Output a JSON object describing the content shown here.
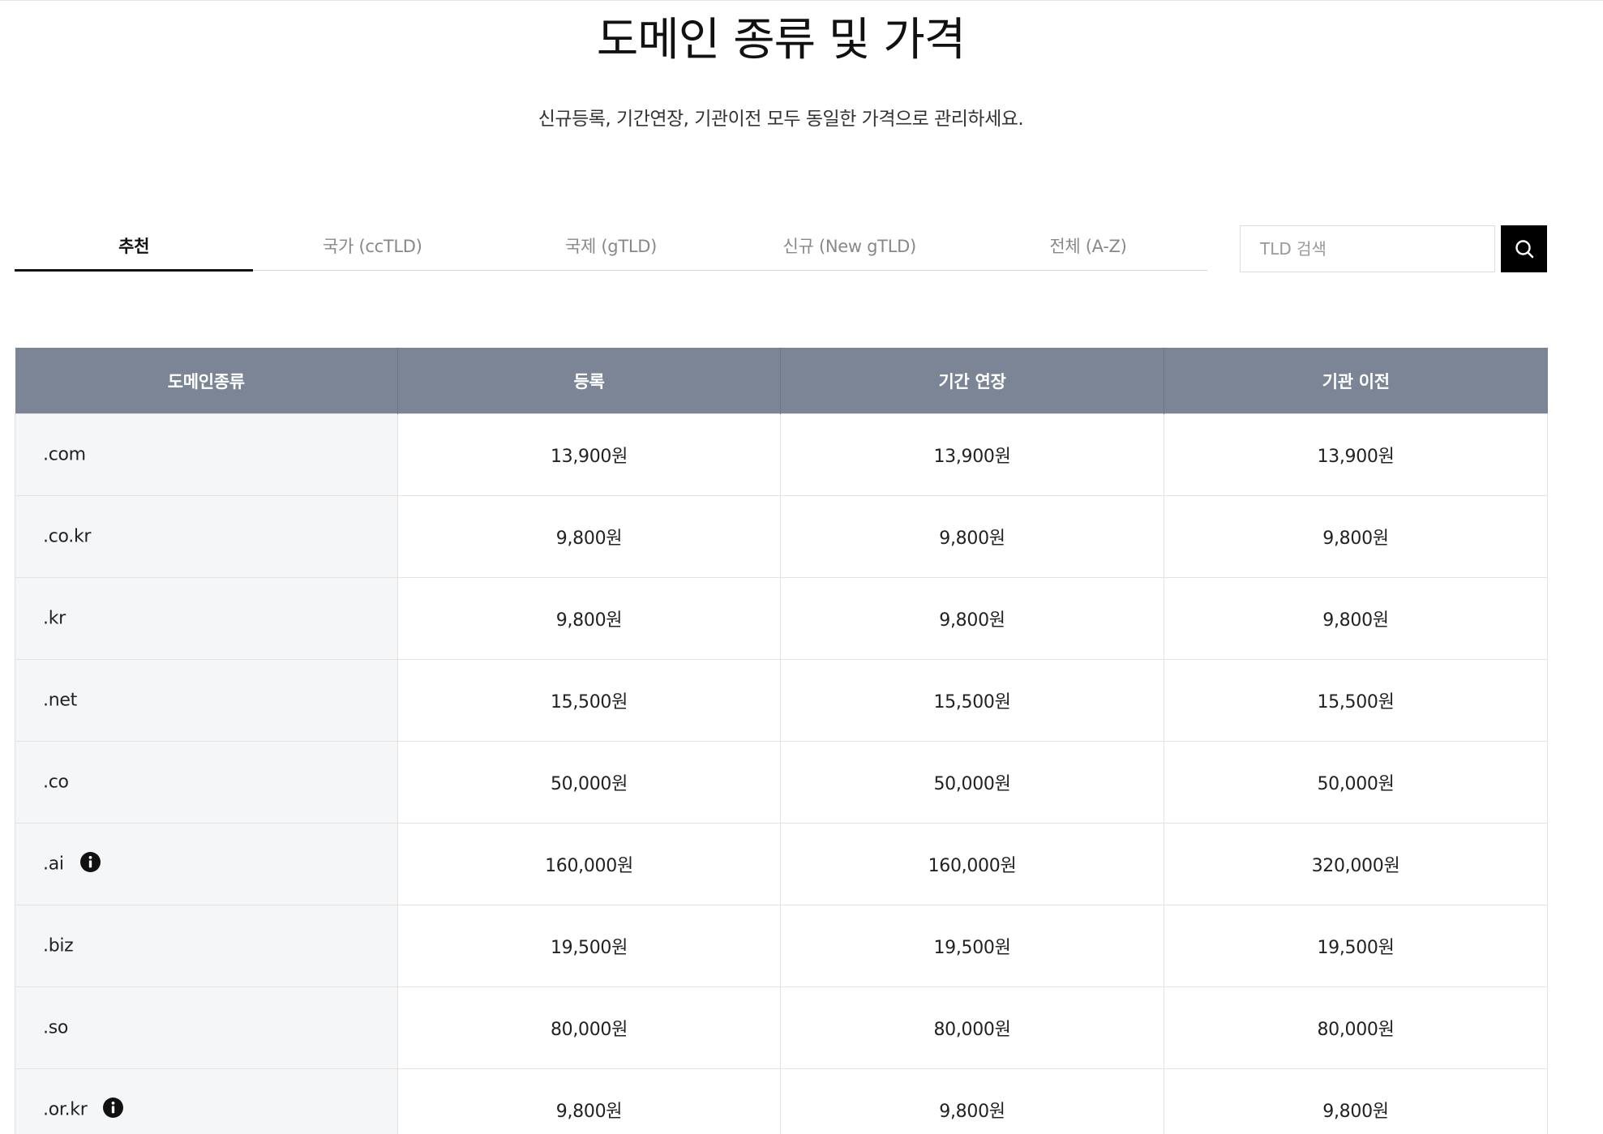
{
  "header": {
    "title": "도메인 종류 및 가격",
    "subtitle": "신규등록, 기간연장, 기관이전 모두 동일한 가격으로 관리하세요."
  },
  "tabs": [
    {
      "label": "추천",
      "active": true
    },
    {
      "label": "국가 (ccTLD)",
      "active": false
    },
    {
      "label": "국제 (gTLD)",
      "active": false
    },
    {
      "label": "신규 (New gTLD)",
      "active": false
    },
    {
      "label": "전체 (A-Z)",
      "active": false
    }
  ],
  "search": {
    "placeholder": "TLD 검색",
    "value": "",
    "button_icon": "search-icon"
  },
  "table": {
    "headers": [
      "도메인종류",
      "등록",
      "기간 연장",
      "기관 이전"
    ],
    "rows": [
      {
        "domain": ".com",
        "info_icon": false,
        "register": "13,900원",
        "renew": "13,900원",
        "transfer": "13,900원"
      },
      {
        "domain": ".co.kr",
        "info_icon": false,
        "register": "9,800원",
        "renew": "9,800원",
        "transfer": "9,800원"
      },
      {
        "domain": ".kr",
        "info_icon": false,
        "register": "9,800원",
        "renew": "9,800원",
        "transfer": "9,800원"
      },
      {
        "domain": ".net",
        "info_icon": false,
        "register": "15,500원",
        "renew": "15,500원",
        "transfer": "15,500원"
      },
      {
        "domain": ".co",
        "info_icon": false,
        "register": "50,000원",
        "renew": "50,000원",
        "transfer": "50,000원"
      },
      {
        "domain": ".ai",
        "info_icon": true,
        "register": "160,000원",
        "renew": "160,000원",
        "transfer": "320,000원"
      },
      {
        "domain": ".biz",
        "info_icon": false,
        "register": "19,500원",
        "renew": "19,500원",
        "transfer": "19,500원"
      },
      {
        "domain": ".so",
        "info_icon": false,
        "register": "80,000원",
        "renew": "80,000원",
        "transfer": "80,000원"
      },
      {
        "domain": ".or.kr",
        "info_icon": true,
        "register": "9,800원",
        "renew": "9,800원",
        "transfer": "9,800원"
      }
    ]
  },
  "colors": {
    "header_bg": "#7b8595",
    "domain_cell_bg": "#f5f6f8",
    "active_tab": "#111111",
    "inactive_tab": "#888888",
    "search_button_bg": "#000000"
  }
}
